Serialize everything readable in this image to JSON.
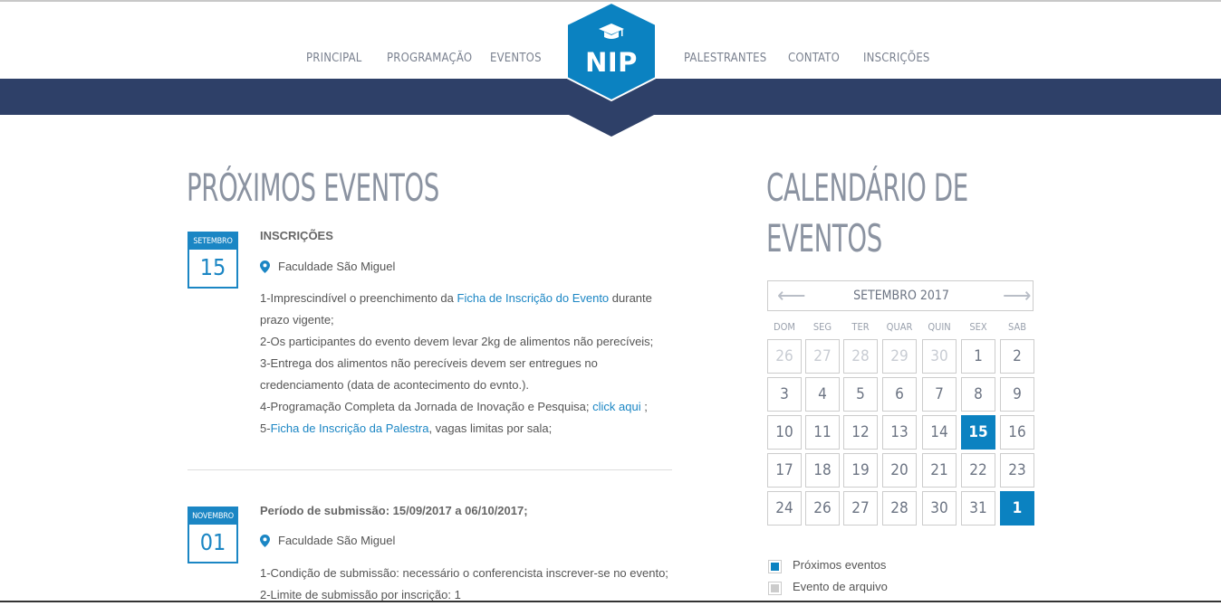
{
  "nav": {
    "items": [
      "PRINCIPAL",
      "PROGRAMAÇÃO",
      "EVENTOS",
      "PALESTRANTES",
      "CONTATO",
      "INSCRIÇÕES"
    ],
    "logo": "NIP"
  },
  "events": {
    "heading": "PRÓXIMOS EVENTOS",
    "list": [
      {
        "month": "SETEMBRO",
        "day": "15",
        "title": "INSCRIÇÕES",
        "location": "Faculdade São Miguel",
        "d1_pre": "1-Imprescindível o preenchimento da ",
        "d1_link": "Ficha de Inscrição do Evento",
        "d1_post": " durante prazo vigente;",
        "d2": "2-Os participantes do evento devem levar 2kg de alimentos não perecíveis;",
        "d3": "3-Entrega dos alimentos não perecíveis devem ser entregues no credenciamento (data de acontecimento do evnto.).",
        "d4_pre": "4-Programação Completa da Jornada de Inovação e Pesquisa; ",
        "d4_link": "click aqui",
        "d4_post": " ;",
        "d5_pre": "5-",
        "d5_link": "Ficha de Inscrição da Palestra",
        "d5_post": ", vagas limitas por sala;"
      },
      {
        "month": "NOVEMBRO",
        "day": "01",
        "title": "Período de submissão: 15/09/2017 a 06/10/2017;",
        "location": "Faculdade São Miguel",
        "d1": "1-Condição de submissão: necessário o conferencista inscrever-se no evento;",
        "d2": "2-Limite de submissão por inscrição: 1"
      }
    ]
  },
  "calendar": {
    "heading_line1": "CALENDÁRIO DE",
    "heading_line2": "EVENTOS",
    "month_label": "SETEMBRO 2017",
    "prev_arrow": "⟵",
    "next_arrow": "⟶",
    "weekdays": [
      "DOM",
      "SEG",
      "TER",
      "QUAR",
      "QUIN",
      "SEX",
      "SAB"
    ],
    "weeks": [
      [
        {
          "d": "26",
          "s": "muted"
        },
        {
          "d": "27",
          "s": "muted"
        },
        {
          "d": "28",
          "s": "muted"
        },
        {
          "d": "29",
          "s": "muted"
        },
        {
          "d": "30",
          "s": "muted"
        },
        {
          "d": "1",
          "s": ""
        },
        {
          "d": "2",
          "s": ""
        }
      ],
      [
        {
          "d": "3",
          "s": ""
        },
        {
          "d": "4",
          "s": ""
        },
        {
          "d": "5",
          "s": ""
        },
        {
          "d": "6",
          "s": ""
        },
        {
          "d": "7",
          "s": ""
        },
        {
          "d": "8",
          "s": ""
        },
        {
          "d": "9",
          "s": ""
        }
      ],
      [
        {
          "d": "10",
          "s": ""
        },
        {
          "d": "11",
          "s": ""
        },
        {
          "d": "12",
          "s": ""
        },
        {
          "d": "13",
          "s": ""
        },
        {
          "d": "14",
          "s": ""
        },
        {
          "d": "15",
          "s": "evt"
        },
        {
          "d": "16",
          "s": ""
        }
      ],
      [
        {
          "d": "17",
          "s": ""
        },
        {
          "d": "18",
          "s": ""
        },
        {
          "d": "19",
          "s": ""
        },
        {
          "d": "20",
          "s": ""
        },
        {
          "d": "21",
          "s": ""
        },
        {
          "d": "22",
          "s": ""
        },
        {
          "d": "23",
          "s": ""
        }
      ],
      [
        {
          "d": "24",
          "s": ""
        },
        {
          "d": "26",
          "s": ""
        },
        {
          "d": "27",
          "s": ""
        },
        {
          "d": "28",
          "s": ""
        },
        {
          "d": "30",
          "s": ""
        },
        {
          "d": "31",
          "s": ""
        },
        {
          "d": "1",
          "s": "evt"
        }
      ]
    ],
    "legend": {
      "upcoming": "Próximos eventos",
      "archive": "Evento de arquivo"
    }
  },
  "colors": {
    "brand": "#1b86c4",
    "navband": "#2e4068",
    "event_day": "#0b82c1"
  }
}
